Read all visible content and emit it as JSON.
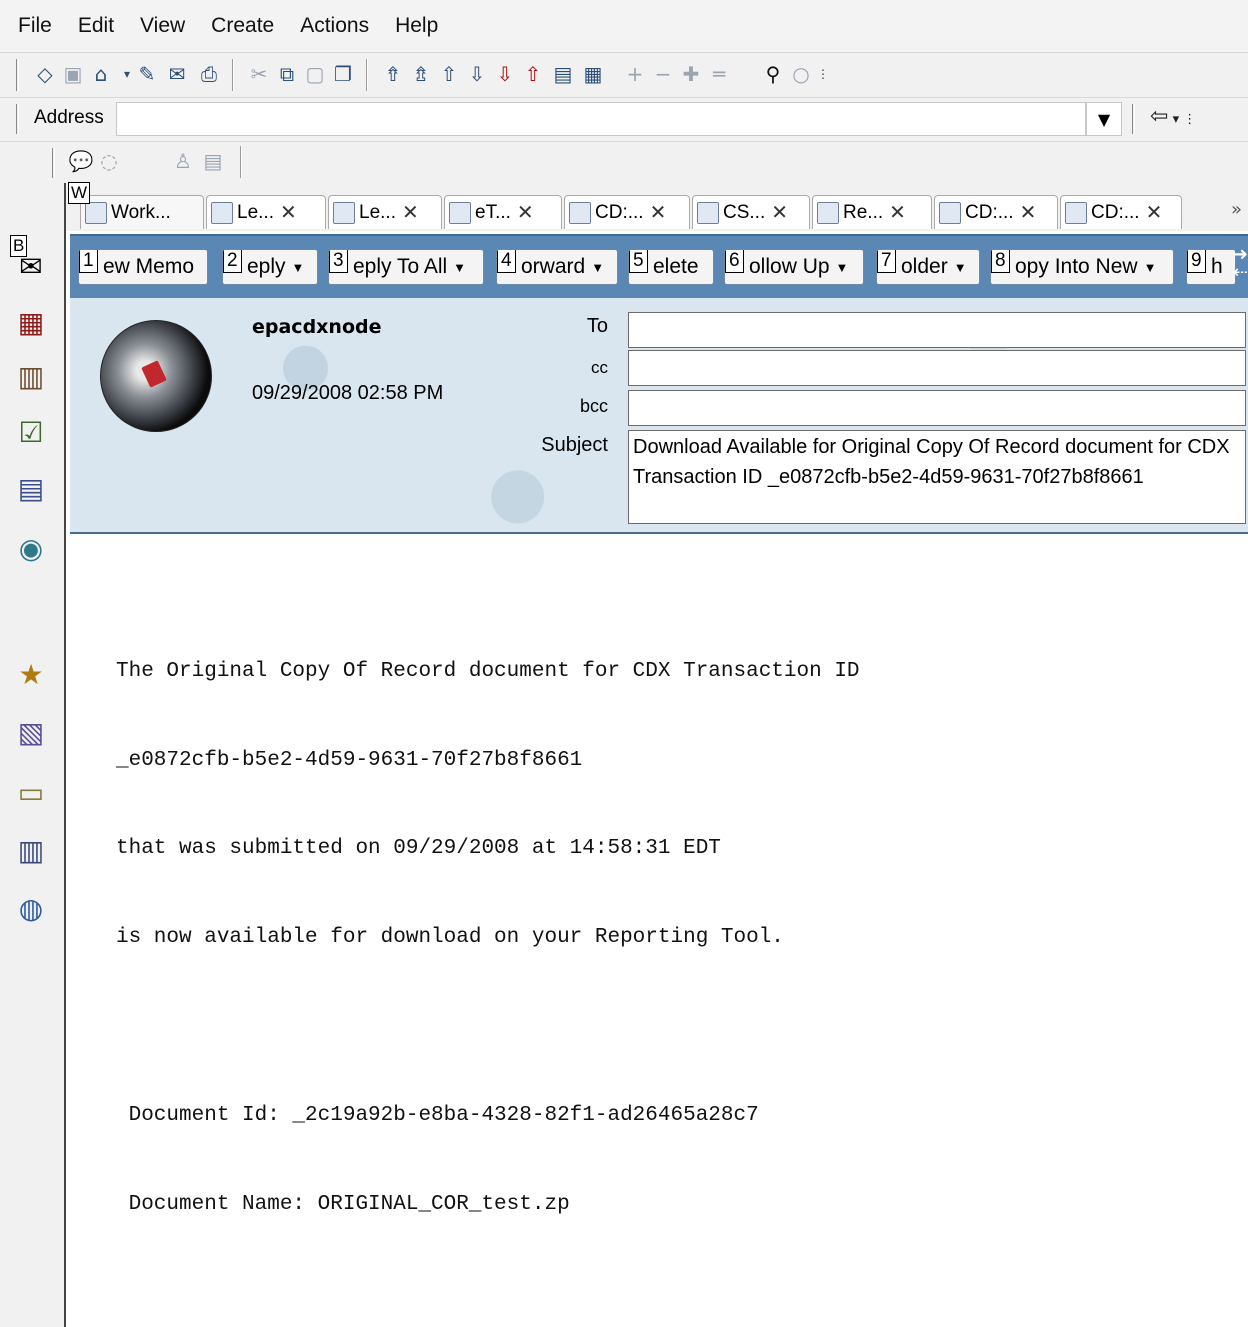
{
  "menu": {
    "items": [
      {
        "label": "File"
      },
      {
        "label": "Edit"
      },
      {
        "label": "View"
      },
      {
        "label": "Create"
      },
      {
        "label": "Actions"
      },
      {
        "label": "Help"
      }
    ]
  },
  "address_bar": {
    "label": "Address",
    "value": ""
  },
  "tabs": [
    {
      "label": "Work...",
      "badge": "W"
    },
    {
      "label": "Le..."
    },
    {
      "label": "Le..."
    },
    {
      "label": "eT..."
    },
    {
      "label": "CD:..."
    },
    {
      "label": "CS..."
    },
    {
      "label": "Re..."
    },
    {
      "label": "CD:..."
    },
    {
      "label": "CD:..."
    }
  ],
  "sidebar": {
    "badge": "B"
  },
  "actions": [
    {
      "num": "1",
      "label": "ew Memo",
      "dropdown": false
    },
    {
      "num": "2",
      "label": "eply",
      "dropdown": true
    },
    {
      "num": "3",
      "label": "eply To All",
      "dropdown": true
    },
    {
      "num": "4",
      "label": "orward",
      "dropdown": true
    },
    {
      "num": "5",
      "label": "elete",
      "dropdown": false
    },
    {
      "num": "6",
      "label": "ollow Up",
      "dropdown": true
    },
    {
      "num": "7",
      "label": "older",
      "dropdown": true
    },
    {
      "num": "8",
      "label": "opy Into New",
      "dropdown": true
    },
    {
      "num": "9",
      "label": "h",
      "dropdown": false
    }
  ],
  "message": {
    "sender": "epacdxnode",
    "date": "09/29/2008 02:58 PM",
    "to_label": "To",
    "to_value": "",
    "cc_label": "cc",
    "cc_value": "",
    "bcc_label": "bcc",
    "bcc_value": "",
    "subject_label": "Subject",
    "subject": "Download Available for Original Copy Of Record document for CDX Transaction ID _e0872cfb-b5e2-4d59-9631-70f27b8f8661",
    "body_lines": [
      "The Original Copy Of Record document for CDX Transaction ID",
      "_e0872cfb-b5e2-4d59-9631-70f27b8f8661",
      "that was submitted on 09/29/2008 at 14:58:31 EDT",
      "is now available for download on your Reporting Tool.",
      "",
      " Document Id: _2c19a92b-e8ba-4328-82f1-ad26465a28c7",
      " Document Name: ORIGINAL_COR_test.zp"
    ]
  }
}
